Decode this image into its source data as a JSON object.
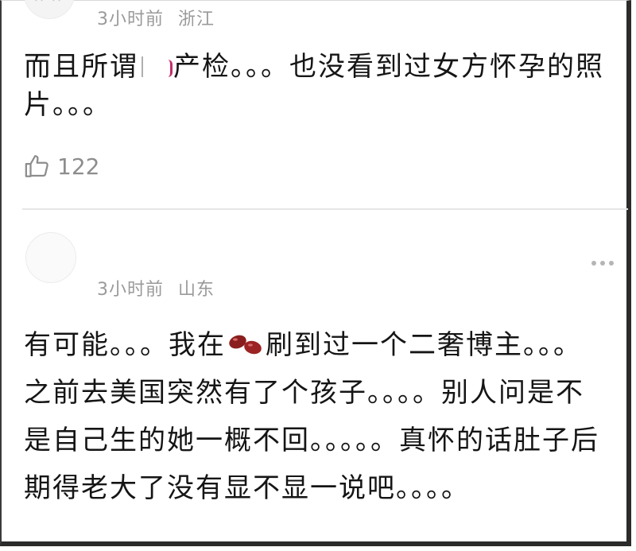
{
  "comments": [
    {
      "time": "3小时前",
      "location": "浙江",
      "text_before": "而且所谓",
      "text_after": "产检。。。也没看到过女方怀孕的照片。。。",
      "likes": "122"
    },
    {
      "time": "3小时前",
      "location": "山东",
      "text_before": "有可能。。。我在",
      "text_after": "刷到过一个二奢博主。。。之前去美国突然有了个孩子。。。。别人问是不是自己生的她一概不回。。。。。真怀的话肚子后期得老大了没有显不显一说吧。。。。"
    }
  ],
  "icons": {
    "like": "thumbs-up-icon",
    "more": "more-dots-icon",
    "emoji": "red-bean-emoji-icon"
  }
}
